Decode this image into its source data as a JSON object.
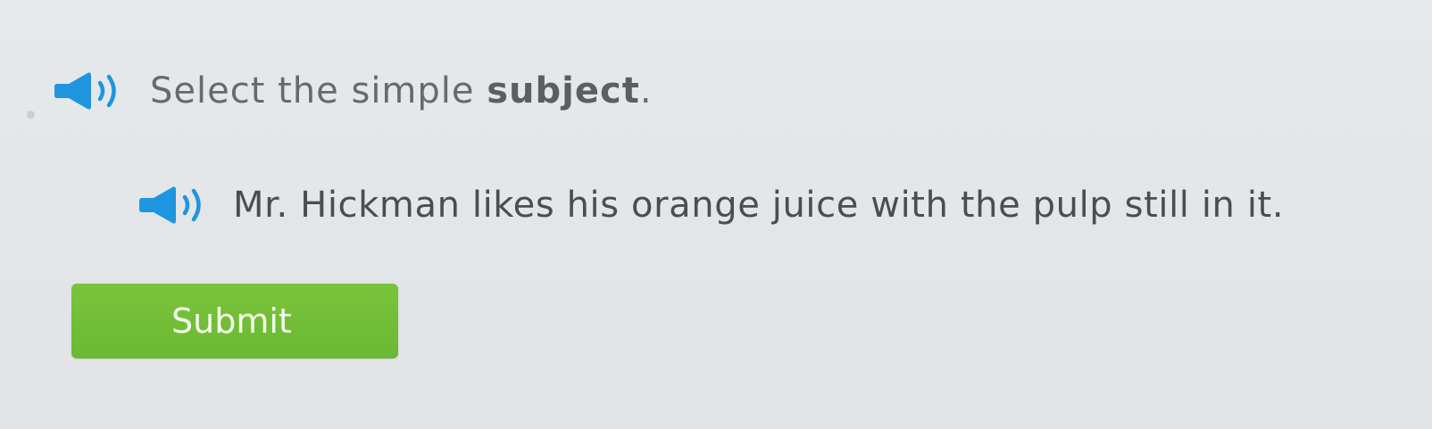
{
  "prompt": {
    "text_before": "Select the simple ",
    "bold_word": "subject",
    "text_after": ".",
    "audio_icon": "speaker-icon"
  },
  "sentence": {
    "words": [
      "Mr.",
      "Hickman",
      "likes",
      "his",
      "orange",
      "juice",
      "with",
      "the",
      "pulp",
      "still",
      "in",
      "it."
    ],
    "audio_icon": "speaker-icon"
  },
  "submit": {
    "label": "Submit"
  },
  "colors": {
    "accent_green": "#6ab833",
    "speaker_blue": "#1f95e0",
    "text_gray": "#666a6e",
    "background": "#e3e6e8"
  }
}
